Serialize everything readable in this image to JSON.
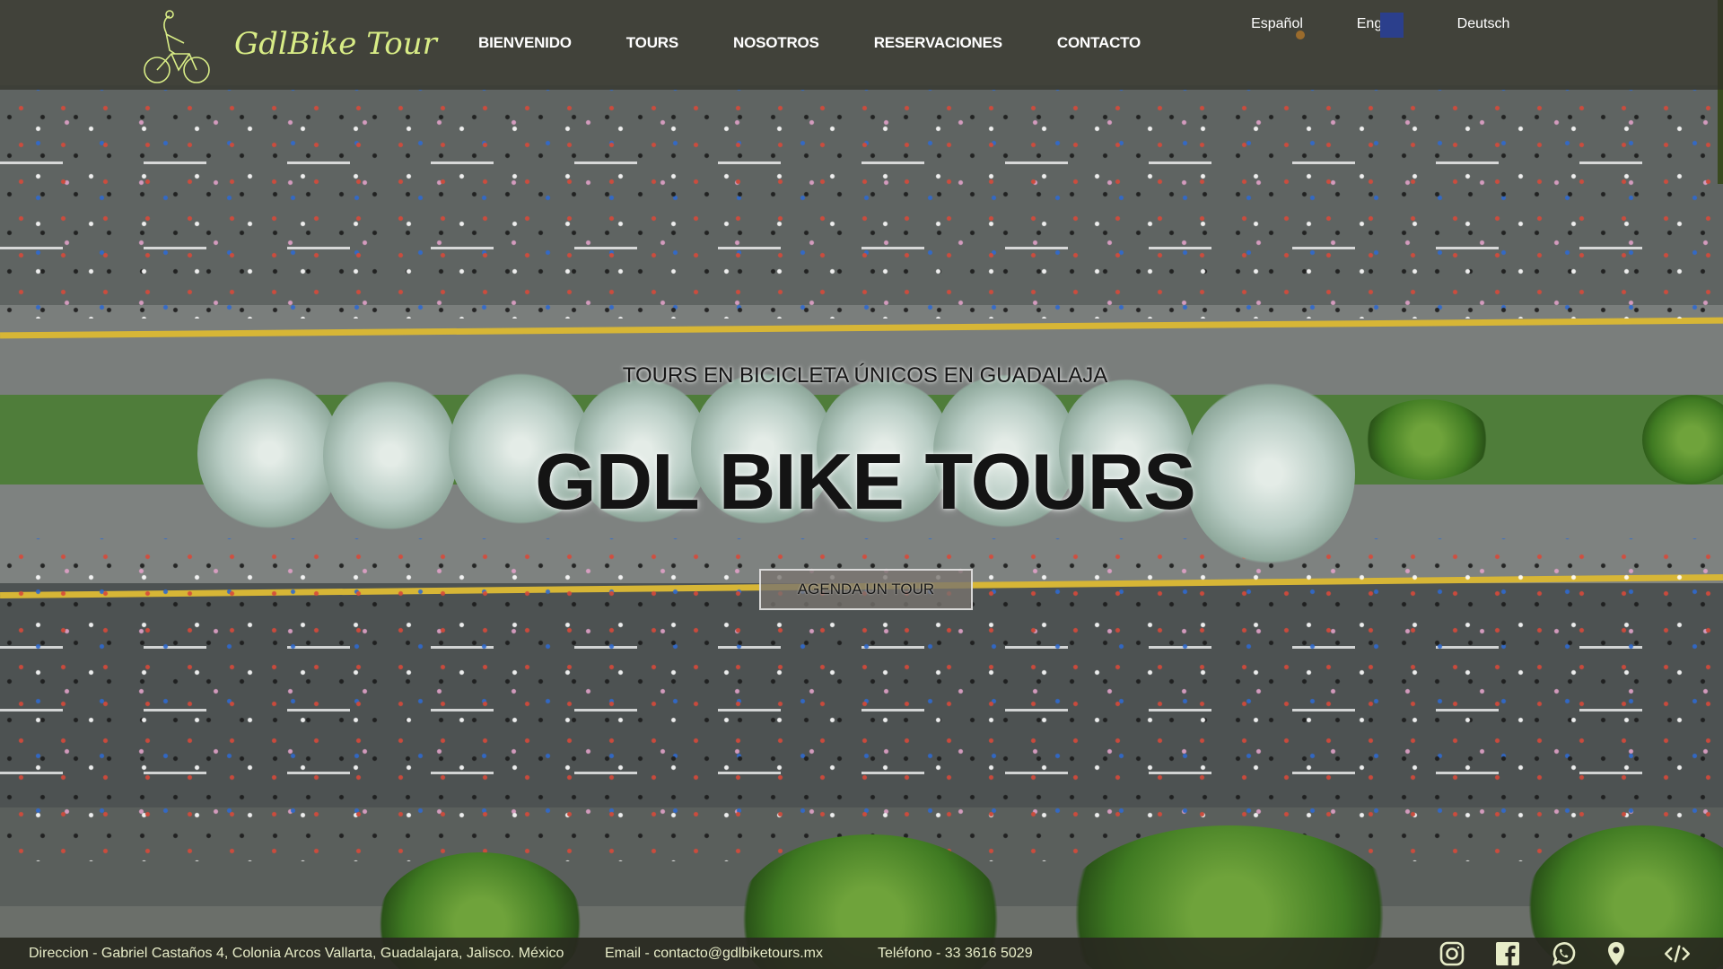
{
  "brand": {
    "name": "GdlBike Tour"
  },
  "nav": {
    "items": [
      {
        "label": "BIENVENIDO"
      },
      {
        "label": "TOURS"
      },
      {
        "label": "NOSOTROS"
      },
      {
        "label": "RESERVACIONES"
      },
      {
        "label": "CONTACTO"
      }
    ]
  },
  "languages": [
    {
      "label": "Español",
      "icon": "mexico-flag-icon"
    },
    {
      "label": "English",
      "icon": "usa-flag-icon"
    },
    {
      "label": "Deutsch",
      "icon": "germany-flag-icon"
    }
  ],
  "hero": {
    "kicker": "TOURS EN BICICLETA ÚNICOS EN GUADALAJA",
    "title": "GDL BIKE TOURS",
    "cta_label": "AGENDA UN TOUR"
  },
  "footer": {
    "address": "Direccion - Gabriel Castaños 4, Colonia Arcos Vallarta, Guadalajara, Jalisco. México",
    "email": "Email - contacto@gdlbiketours.mx",
    "phone": "Teléfono - 33 3616 5029",
    "icons": [
      "instagram-icon",
      "facebook-icon",
      "whatsapp-icon",
      "map-pin-icon",
      "code-icon"
    ]
  },
  "colors": {
    "brand_accent": "#d8ec86",
    "header_bg": "#303028",
    "footer_text": "#e7ecc8"
  }
}
